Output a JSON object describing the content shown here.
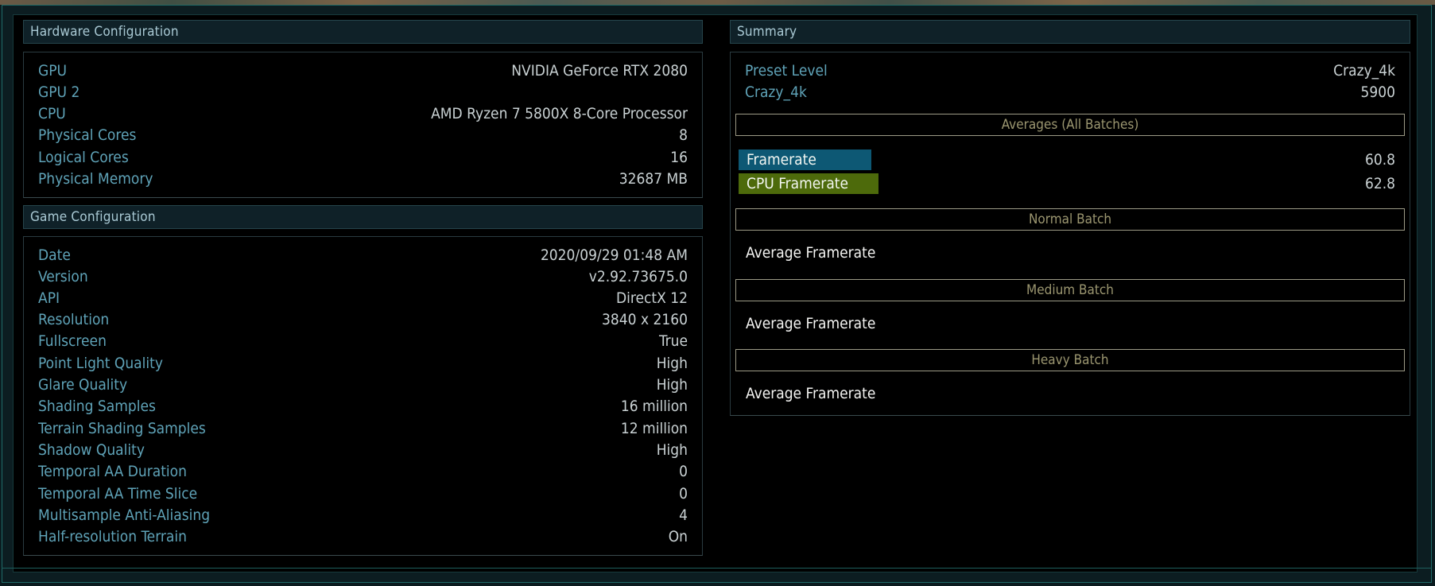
{
  "hardware": {
    "title": "Hardware Configuration",
    "rows": [
      {
        "label": "GPU",
        "value": "NVIDIA GeForce RTX 2080"
      },
      {
        "label": "GPU 2",
        "value": ""
      },
      {
        "label": "CPU",
        "value": "AMD Ryzen 7 5800X 8-Core Processor"
      },
      {
        "label": "Physical Cores",
        "value": "8"
      },
      {
        "label": "Logical Cores",
        "value": "16"
      },
      {
        "label": "Physical Memory",
        "value": "32687 MB"
      }
    ]
  },
  "game": {
    "title": "Game Configuration",
    "rows": [
      {
        "label": "Date",
        "value": "2020/09/29 01:48 AM"
      },
      {
        "label": "Version",
        "value": "v2.92.73675.0"
      },
      {
        "label": "API",
        "value": "DirectX 12"
      },
      {
        "label": "Resolution",
        "value": "3840 x 2160"
      },
      {
        "label": "Fullscreen",
        "value": "True"
      },
      {
        "label": "Point Light Quality",
        "value": "High"
      },
      {
        "label": "Glare Quality",
        "value": "High"
      },
      {
        "label": "Shading Samples",
        "value": "16 million"
      },
      {
        "label": "Terrain Shading Samples",
        "value": "12 million"
      },
      {
        "label": "Shadow Quality",
        "value": "High"
      },
      {
        "label": "Temporal AA Duration",
        "value": "0"
      },
      {
        "label": "Temporal AA Time Slice",
        "value": "0"
      },
      {
        "label": "Multisample Anti-Aliasing",
        "value": "4"
      },
      {
        "label": "Half-resolution Terrain",
        "value": "On"
      }
    ]
  },
  "summary": {
    "title": "Summary",
    "rows": [
      {
        "label": "Preset Level",
        "value": "Crazy_4k"
      },
      {
        "label": "Crazy_4k",
        "value": "5900"
      }
    ],
    "averages": {
      "title": "Averages (All Batches)",
      "framerate_label": "Framerate",
      "framerate_value": "60.8",
      "cpu_framerate_label": "CPU Framerate",
      "cpu_framerate_value": "62.8",
      "framerate_color": "#0d5874",
      "cpu_framerate_color": "#4d6a0b"
    },
    "batches": [
      {
        "title": "Normal Batch",
        "row_label": "Average Framerate"
      },
      {
        "title": "Medium Batch",
        "row_label": "Average Framerate"
      },
      {
        "title": "Heavy Batch",
        "row_label": "Average Framerate"
      }
    ]
  }
}
